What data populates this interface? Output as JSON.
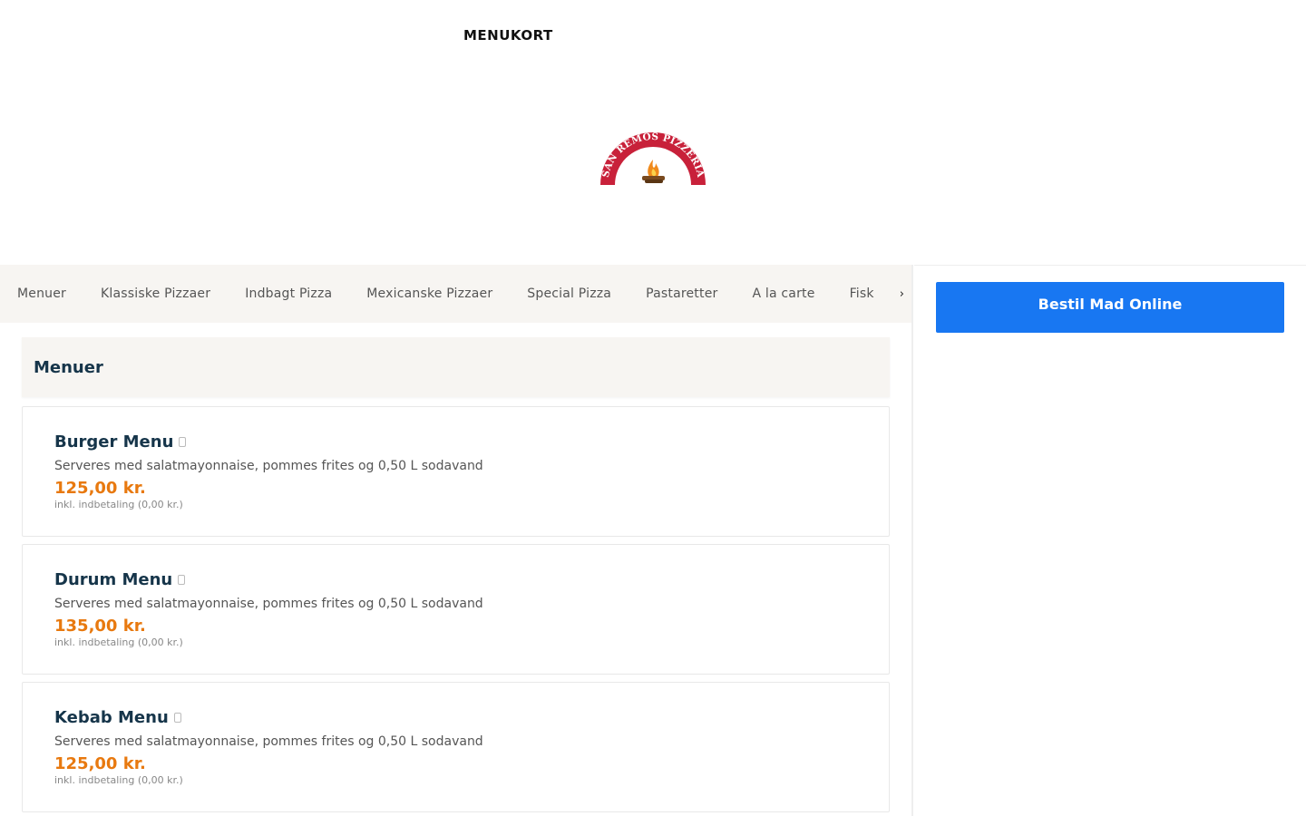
{
  "header": {
    "nav_label": "MENUKORT",
    "logo_text": "SAN REMOS PIZZERIA"
  },
  "categories": [
    "Menuer",
    "Klassiske Pizzaer",
    "Indbagt Pizza",
    "Mexicanske Pizzaer",
    "Special Pizza",
    "Pastaretter",
    "A la carte",
    "Fisk"
  ],
  "more_icon": "chevron-right-icon",
  "section": {
    "title": "Menuer"
  },
  "items": [
    {
      "name": "Burger Menu",
      "description": "Serveres med salatmayonnaise, pommes frites og 0,50 L sodavand",
      "price": "125,00 kr.",
      "note": "inkl. indbetaling (0,00 kr.)"
    },
    {
      "name": "Durum Menu",
      "description": "Serveres med salatmayonnaise, pommes frites og 0,50 L sodavand",
      "price": "135,00 kr.",
      "note": "inkl. indbetaling (0,00 kr.)"
    },
    {
      "name": "Kebab Menu",
      "description": "Serveres med salatmayonnaise, pommes frites og 0,50 L sodavand",
      "price": "125,00 kr.",
      "note": "inkl. indbetaling (0,00 kr.)"
    }
  ],
  "sidebar": {
    "order_label": "Bestil Mad Online"
  },
  "colors": {
    "brand_red": "#c8213a",
    "price_orange": "#e8790f",
    "button_blue": "#1877f2",
    "heading_navy": "#16354a"
  }
}
